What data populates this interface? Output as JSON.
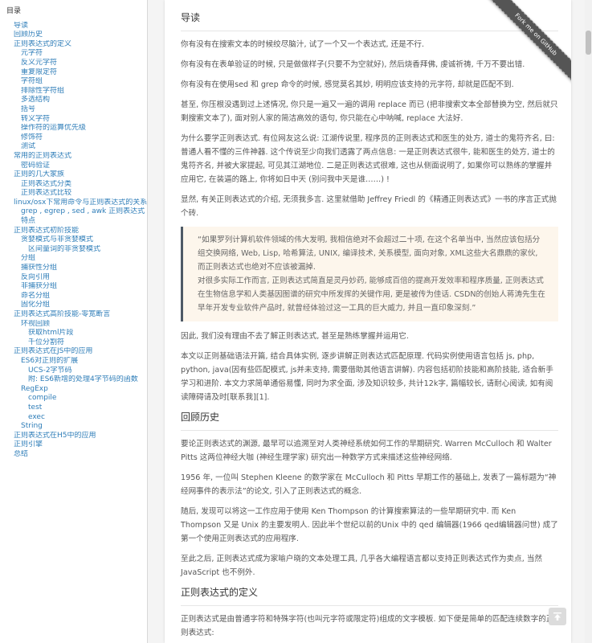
{
  "sidebar": {
    "title": "目录",
    "items": [
      {
        "label": "导读",
        "level": 1
      },
      {
        "label": "回顾历史",
        "level": 1
      },
      {
        "label": "正则表达式的定义",
        "level": 1
      },
      {
        "label": "元字符",
        "level": 2
      },
      {
        "label": "反义元字符",
        "level": 2
      },
      {
        "label": "重复限定符",
        "level": 2
      },
      {
        "label": "字符组",
        "level": 2
      },
      {
        "label": "排除性字符组",
        "level": 2
      },
      {
        "label": "多选结构",
        "level": 2
      },
      {
        "label": "括号",
        "level": 2
      },
      {
        "label": "转义字符",
        "level": 2
      },
      {
        "label": "操作符的运算优先级",
        "level": 2
      },
      {
        "label": "修饰符",
        "level": 2
      },
      {
        "label": "测试",
        "level": 2
      },
      {
        "label": "常用的正则表达式",
        "level": 1
      },
      {
        "label": "密码验证",
        "level": 2
      },
      {
        "label": "正则的几大家族",
        "level": 1
      },
      {
        "label": "正则表达式分类",
        "level": 2
      },
      {
        "label": "正则表达式比较",
        "level": 2
      },
      {
        "label": "linux/osx下常用命令与正则表达式的关系",
        "level": 1
      },
      {
        "label": "grep , egrep , sed , awk 正则表达式特点",
        "level": 2
      },
      {
        "label": "正则表达式初阶技能",
        "level": 1
      },
      {
        "label": "贪婪模式与非贪婪模式",
        "level": 2
      },
      {
        "label": "区间量词的非贪婪模式",
        "level": 3
      },
      {
        "label": "分组",
        "level": 2
      },
      {
        "label": "捕获性分组",
        "level": 2
      },
      {
        "label": "反向引用",
        "level": 2
      },
      {
        "label": "非捕获分组",
        "level": 2
      },
      {
        "label": "命名分组",
        "level": 2
      },
      {
        "label": "固化分组",
        "level": 2
      },
      {
        "label": "正则表达式高阶技能-零宽断言",
        "level": 1
      },
      {
        "label": "环视回顾",
        "level": 2
      },
      {
        "label": "获取html片段",
        "level": 3
      },
      {
        "label": "千位分割符",
        "level": 3
      },
      {
        "label": "正则表达式在JS中的应用",
        "level": 1
      },
      {
        "label": "ES6对正则的扩展",
        "level": 2
      },
      {
        "label": "UCS-2字节码",
        "level": 3
      },
      {
        "label": "附: ES6新增的处理4字节码的函数",
        "level": 3
      },
      {
        "label": "RegExp",
        "level": 2
      },
      {
        "label": "compile",
        "level": 3
      },
      {
        "label": "test",
        "level": 3
      },
      {
        "label": "exec",
        "level": 3
      },
      {
        "label": "String",
        "level": 2
      },
      {
        "label": "正则表达式在H5中的应用",
        "level": 1
      },
      {
        "label": "正则引擎",
        "level": 1
      },
      {
        "label": "总结",
        "level": 1
      }
    ]
  },
  "ribbon": {
    "label": "Fork me on GitHub"
  },
  "sections": [
    {
      "heading": "导读",
      "paragraphs": [
        "你有没有在搜索文本的时候绞尽脑汁, 试了一个又一个表达式, 还是不行.",
        "你有没有在表单验证的时候, 只是做做样子(只要不为空就好), 然后烧香拜佛, 虔诚祈祷, 千万不要出错.",
        "你有没有在使用sed 和 grep 命令的时候, 感觉莫名其妙, 明明应该支持的元字符, 却就是匹配不到.",
        "甚至, 你压根没遇到过上述情况, 你只是一遍又一遍的调用 replace 而已 (把非搜索文本全部替换为空, 然后就只剩搜索文本了), 面对别人家的简洁高效的语句, 你只能在心中呐喊, replace 大法好.",
        "为什么要学正则表达式. 有位网友这么说: 江湖传说里, 程序员的正则表达式和医生的处方, 道士的鬼符齐名, 曰: 普通人看不懂的三件神器. 这个传说至少向我们透露了两点信息: 一是正则表达式很牛, 能和医生的处方, 道士的鬼符齐名, 并被大家提起, 可见其江湖地位. 二是正则表达式很难, 这也从侧面说明了, 如果你可以熟练的掌握并应用它, 在装逼的路上, 你将如日中天 (别问我中天是谁……) !",
        "显然, 有关正则表达式的介绍, 无须我多言. 这里就借助 Jeffrey Friedl 的《精通正则表达式》一书的序言正式抛个砖."
      ],
      "quote": [
        "“如果罗列计算机软件领域的伟大发明, 我相信绝对不会超过二十项, 在这个名单当中, 当然应该包括分组交换网络, Web, Lisp, 哈希算法, UNIX, 编译技术, 关系模型, 面向对象, XML这些大名鼎鼎的家伙, 而正则表达式也绝对不应该被漏掉.",
        "对很多实际工作而言, 正则表达式简直是灵丹妙药, 能够成百倍的提高开发效率和程序质量, 正则表达式在生物信息学和人类基因图谱的研究中所发挥的关键作用, 更是被传为佳话. CSDN的创始人蒋涛先生在早年开发专业软件产品时, 就曾经体验过这一工具的巨大威力, 并且一直印象深刻.”"
      ],
      "after": [
        "因此, 我们没有理由不去了解正则表达式, 甚至是熟练掌握并运用它.",
        "本文以正则基础语法开篇, 结合具体实例, 逐步讲解正则表达式匹配原理. 代码实例使用语言包括 js, php, python, java(因有些匹配模式, js并未支持, 需要借助其他语言讲解). 内容包括初阶技能和高阶技能, 适合新手学习和进阶. 本文力求简单通俗易懂, 同时为求全面, 涉及知识较多, 共计12k字, 篇幅较长, 请耐心阅读, 如有阅读障碍请及时[联系我][1]."
      ]
    },
    {
      "heading": "回顾历史",
      "paragraphs": [
        "要论正则表达式的渊源, 最早可以追溯至对人类神经系统如何工作的早期研究. Warren McCulloch 和 Walter Pitts 这两位神经大咖 (神经生理学家) 研究出一种数学方式来描述这些神经网络.",
        "1956 年, 一位叫 Stephen Kleene 的数学家在 McCulloch 和 Pitts 早期工作的基础上, 发表了一篇标题为“神经网事件的表示法”的论文, 引入了正则表达式的概念.",
        "随后, 发现可以将这一工作应用于使用 Ken Thompson 的计算搜索算法的一些早期研究中. 而 Ken Thompson 又是 Unix 的主要发明人. 因此半个世纪以前的Unix 中的 qed 编辑器(1966 qed编辑器问世) 成了第一个使用正则表达式的应用程序.",
        "至此之后, 正则表达式成为家喻户晓的文本处理工具, 几乎各大编程语言都以支持正则表达式作为卖点, 当然 JavaScript 也不例外."
      ]
    },
    {
      "heading": "正则表达式的定义",
      "paragraphs": [
        "正则表达式是由普通字符和特殊字符(也叫元字符或限定符)组成的文字模板. 如下便是简单的匹配连续数字的正则表达式:"
      ]
    }
  ]
}
